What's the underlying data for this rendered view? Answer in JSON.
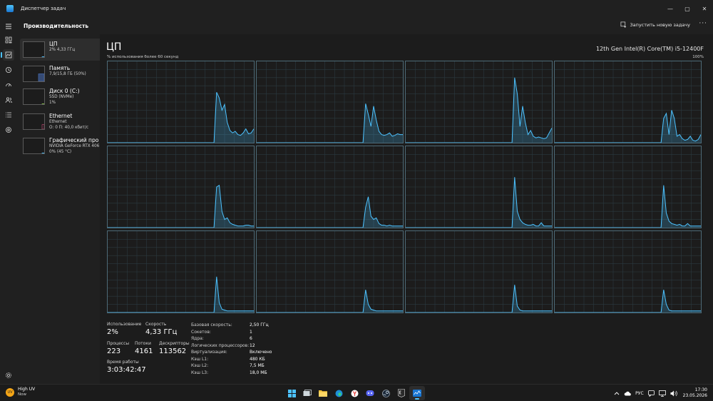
{
  "window": {
    "title": "Диспетчер задач",
    "controls": [
      "—",
      "▢",
      "✕"
    ]
  },
  "header": {
    "page_title": "Производительность",
    "run_task_label": "Запустить новую задачу",
    "more_label": "···"
  },
  "sidebar": {
    "items": [
      {
        "name": "ЦП",
        "line1": "2% 4,33 ГГц",
        "line2": "",
        "level": 0.02,
        "color": "#4cc2ff"
      },
      {
        "name": "Память",
        "line1": "7,9/15,8 ГБ (50%)",
        "line2": "",
        "level": 0.5,
        "color": "#4d78c9"
      },
      {
        "name": "Диск 0 (C:)",
        "line1": "SSD (NVMe)",
        "line2": "1%",
        "level": 0.01,
        "color": "#8bc34a"
      },
      {
        "name": "Ethernet",
        "line1": "Ethernet",
        "line2": "О: 0 П: 40,0 кбит/с",
        "level": 0.3,
        "color": "#d24b7c"
      },
      {
        "name": "Графический про",
        "line1": "NVIDIA GeForce RTX 406",
        "line2": "0% (45 °C)",
        "level": 0.0,
        "color": "#4cc2ff"
      }
    ]
  },
  "cpu": {
    "title": "ЦП",
    "model": "12th Gen Intel(R) Core(TM) i5-12400F",
    "graph_label": "% использования более 60 секунд",
    "graph_max": "100%",
    "graph_color": "#4cc2ff",
    "cores": [
      [
        0,
        0,
        0,
        0,
        0,
        0,
        0,
        0,
        0,
        0,
        0,
        0,
        0,
        0,
        0,
        0,
        0,
        0,
        0,
        0,
        0,
        0,
        0,
        0,
        0,
        0,
        0,
        0,
        0,
        0,
        0,
        0,
        0,
        0,
        0,
        0,
        0,
        0,
        0,
        0,
        0,
        62,
        55,
        40,
        47,
        25,
        15,
        12,
        14,
        10,
        9,
        12,
        17,
        11,
        12,
        17
      ],
      [
        0,
        0,
        0,
        0,
        0,
        0,
        0,
        0,
        0,
        0,
        0,
        0,
        0,
        0,
        0,
        0,
        0,
        0,
        0,
        0,
        0,
        0,
        0,
        0,
        0,
        0,
        0,
        0,
        0,
        0,
        0,
        0,
        0,
        0,
        0,
        0,
        0,
        0,
        0,
        0,
        0,
        48,
        35,
        20,
        45,
        28,
        14,
        10,
        9,
        10,
        12,
        8,
        9,
        11,
        10,
        10
      ],
      [
        0,
        0,
        0,
        0,
        0,
        0,
        0,
        0,
        0,
        0,
        0,
        0,
        0,
        0,
        0,
        0,
        0,
        0,
        0,
        0,
        0,
        0,
        0,
        0,
        0,
        0,
        0,
        0,
        0,
        0,
        0,
        0,
        0,
        0,
        0,
        0,
        0,
        0,
        0,
        0,
        0,
        80,
        60,
        20,
        45,
        25,
        10,
        15,
        8,
        6,
        7,
        6,
        5,
        6,
        12,
        18
      ],
      [
        0,
        0,
        0,
        0,
        0,
        0,
        0,
        0,
        0,
        0,
        0,
        0,
        0,
        0,
        0,
        0,
        0,
        0,
        0,
        0,
        0,
        0,
        0,
        0,
        0,
        0,
        0,
        0,
        0,
        0,
        0,
        0,
        0,
        0,
        0,
        0,
        0,
        0,
        0,
        0,
        0,
        30,
        36,
        10,
        40,
        30,
        8,
        10,
        5,
        3,
        4,
        8,
        3,
        2,
        4,
        10
      ],
      [
        0,
        0,
        0,
        0,
        0,
        0,
        0,
        0,
        0,
        0,
        0,
        0,
        0,
        0,
        0,
        0,
        0,
        0,
        0,
        0,
        0,
        0,
        0,
        0,
        0,
        0,
        0,
        0,
        0,
        0,
        0,
        0,
        0,
        0,
        0,
        0,
        0,
        0,
        0,
        0,
        0,
        50,
        52,
        20,
        10,
        12,
        6,
        4,
        3,
        2,
        2,
        2,
        3,
        3,
        2,
        2
      ],
      [
        0,
        0,
        0,
        0,
        0,
        0,
        0,
        0,
        0,
        0,
        0,
        0,
        0,
        0,
        0,
        0,
        0,
        0,
        0,
        0,
        0,
        0,
        0,
        0,
        0,
        0,
        0,
        0,
        0,
        0,
        0,
        0,
        0,
        0,
        0,
        0,
        0,
        0,
        0,
        0,
        0,
        25,
        38,
        14,
        10,
        12,
        5,
        3,
        3,
        2,
        3,
        2,
        2,
        2,
        2,
        2
      ],
      [
        0,
        0,
        0,
        0,
        0,
        0,
        0,
        0,
        0,
        0,
        0,
        0,
        0,
        0,
        0,
        0,
        0,
        0,
        0,
        0,
        0,
        0,
        0,
        0,
        0,
        0,
        0,
        0,
        0,
        0,
        0,
        0,
        0,
        0,
        0,
        0,
        0,
        0,
        0,
        0,
        0,
        62,
        20,
        10,
        6,
        4,
        3,
        3,
        4,
        2,
        2,
        6,
        2,
        2,
        2,
        2
      ],
      [
        0,
        0,
        0,
        0,
        0,
        0,
        0,
        0,
        0,
        0,
        0,
        0,
        0,
        0,
        0,
        0,
        0,
        0,
        0,
        0,
        0,
        0,
        0,
        0,
        0,
        0,
        0,
        0,
        0,
        0,
        0,
        0,
        0,
        0,
        0,
        0,
        0,
        0,
        0,
        0,
        0,
        52,
        18,
        8,
        5,
        4,
        3,
        4,
        2,
        2,
        5,
        2,
        2,
        2,
        2,
        2
      ],
      [
        0,
        0,
        0,
        0,
        0,
        0,
        0,
        0,
        0,
        0,
        0,
        0,
        0,
        0,
        0,
        0,
        0,
        0,
        0,
        0,
        0,
        0,
        0,
        0,
        0,
        0,
        0,
        0,
        0,
        0,
        0,
        0,
        0,
        0,
        0,
        0,
        0,
        0,
        0,
        0,
        0,
        44,
        12,
        4,
        3,
        2,
        2,
        2,
        2,
        2,
        2,
        2,
        2,
        2,
        2,
        2
      ],
      [
        0,
        0,
        0,
        0,
        0,
        0,
        0,
        0,
        0,
        0,
        0,
        0,
        0,
        0,
        0,
        0,
        0,
        0,
        0,
        0,
        0,
        0,
        0,
        0,
        0,
        0,
        0,
        0,
        0,
        0,
        0,
        0,
        0,
        0,
        0,
        0,
        0,
        0,
        0,
        0,
        0,
        28,
        10,
        4,
        3,
        2,
        2,
        2,
        2,
        2,
        2,
        2,
        2,
        2,
        2,
        2
      ],
      [
        0,
        0,
        0,
        0,
        0,
        0,
        0,
        0,
        0,
        0,
        0,
        0,
        0,
        0,
        0,
        0,
        0,
        0,
        0,
        0,
        0,
        0,
        0,
        0,
        0,
        0,
        0,
        0,
        0,
        0,
        0,
        0,
        0,
        0,
        0,
        0,
        0,
        0,
        0,
        0,
        0,
        34,
        8,
        3,
        2,
        2,
        2,
        2,
        2,
        2,
        2,
        2,
        2,
        2,
        2,
        2
      ],
      [
        0,
        0,
        0,
        0,
        0,
        0,
        0,
        0,
        0,
        0,
        0,
        0,
        0,
        0,
        0,
        0,
        0,
        0,
        0,
        0,
        0,
        0,
        0,
        0,
        0,
        0,
        0,
        0,
        0,
        0,
        0,
        0,
        0,
        0,
        0,
        0,
        0,
        0,
        0,
        0,
        0,
        28,
        10,
        3,
        2,
        2,
        2,
        2,
        2,
        2,
        2,
        2,
        2,
        2,
        2,
        2
      ]
    ]
  },
  "stats": {
    "utilization": {
      "label": "Использование",
      "value": "2%"
    },
    "speed": {
      "label": "Скорость",
      "value": "4,33 ГГц"
    },
    "processes": {
      "label": "Процессы",
      "value": "223"
    },
    "threads": {
      "label": "Потоки",
      "value": "4161"
    },
    "handles": {
      "label": "Дескрипторы",
      "value": "113562"
    },
    "uptime": {
      "label": "Время работы",
      "value": "3:03:42:47"
    }
  },
  "specs": [
    {
      "key": "Базовая скорость:",
      "value": "2,50 ГГц"
    },
    {
      "key": "Сокетов:",
      "value": "1"
    },
    {
      "key": "Ядра:",
      "value": "6"
    },
    {
      "key": "Логических процессоров:",
      "value": "12"
    },
    {
      "key": "Виртуализация:",
      "value": "Включено"
    },
    {
      "key": "Кэш L1:",
      "value": "480 КБ"
    },
    {
      "key": "Кэш L2:",
      "value": "7,5 МБ"
    },
    {
      "key": "Кэш L3:",
      "value": "18,0 МБ"
    }
  ],
  "taskbar": {
    "weather_title": "High UV",
    "weather_sub": "Now",
    "weather_badge": "UV",
    "language": "РУС",
    "time": "17:30",
    "date": "23.05.2026"
  }
}
